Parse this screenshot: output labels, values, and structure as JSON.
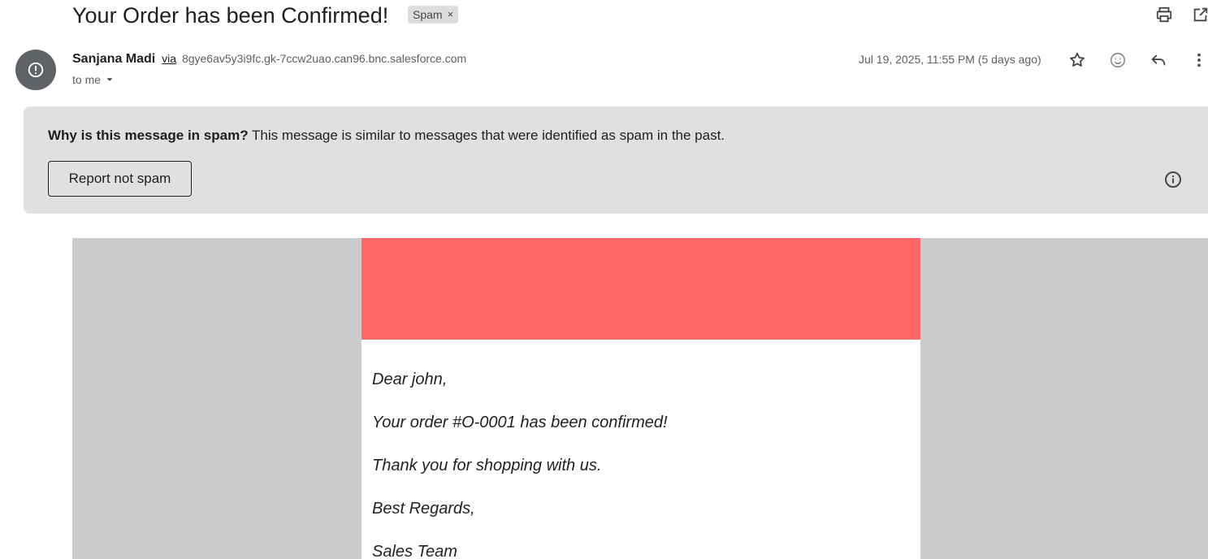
{
  "message": {
    "subject": "Your Order has been Confirmed!",
    "label_chip": "Spam",
    "label_remove": "×"
  },
  "toolbar": {
    "icons": [
      "print-icon",
      "open-in-new-window-icon"
    ]
  },
  "sender": {
    "name": "Sanjana Madi",
    "via_label": "via",
    "via_address": "8gye6av5y3i9fc.gk-7ccw2uao.can96.bnc.salesforce.com",
    "recipient": "to me",
    "date": "Jul 19, 2025, 11:55 PM (5 days ago)",
    "actions": [
      "star-icon",
      "emoji-reaction-icon",
      "reply-icon",
      "more-options-icon"
    ]
  },
  "spam_banner": {
    "question": "Why is this message in spam?",
    "explanation": "This message is similar to messages that were identified as spam in the past.",
    "button": "Report not spam"
  },
  "email_body": {
    "header_color": "#ff6666",
    "lines": [
      "Dear john,",
      "Your order #O-0001 has been confirmed!",
      "Thank you for shopping with us.",
      "Best Regards,",
      "Sales Team"
    ]
  },
  "colors": {
    "banner_bg": "#e0e0e0",
    "avatar_bg": "#5f6368",
    "canvas_bg": "#cccccc"
  }
}
